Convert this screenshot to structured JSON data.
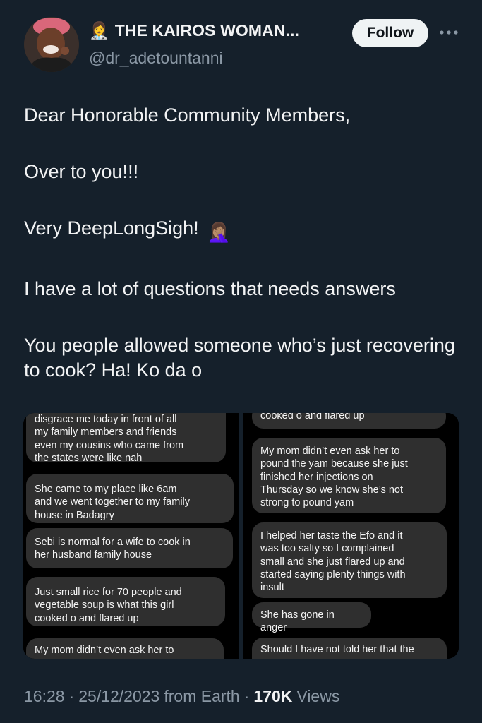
{
  "author": {
    "display_name": "THE KAIROS WOMAN...",
    "badge_emoji": "👩‍⚕️",
    "handle": "@dr_adetountanni",
    "avatar_icon": "avatar-photo"
  },
  "actions": {
    "follow_label": "Follow",
    "more_icon": "more-icon"
  },
  "tweet": {
    "paragraphs": [
      "Dear Honorable Community Members,",
      "Over to you!!!",
      "Very DeepLongSigh!",
      "I have a lot of questions that needs answers",
      "You people allowed someone who’s just recovering to cook? Ha! Ko da o"
    ],
    "facepalm_emoji": "🤦🏽‍♀️"
  },
  "media": {
    "left_messages": [
      "disgrace me today in front of all\nmy family members and friends\neven my cousins who came from\nthe states were like nah",
      "She came to my place like 6am\nand we went together to my family\nhouse in Badagry",
      "Sebi is normal for a wife to cook in\nher husband family house",
      "Just small rice for 70 people and\nvegetable soup is what this girl\ncooked o and flared up",
      "My mom didn’t even ask her to"
    ],
    "right_messages": [
      "cooked o and flared up",
      "My mom didn’t even ask her to\npound the yam because she just\nfinished her injections on\nThursday so we know she’s not\nstrong to pound yam",
      "I helped her taste the Efo and it\nwas too salty so I complained\nsmall and she just flared up and\nstarted saying plenty things with\ninsult",
      "She has gone in anger",
      "Should I have not told her that the"
    ]
  },
  "footer": {
    "time": "16:28",
    "separator": "·",
    "date": "25/12/2023",
    "source": "from Earth",
    "views_count": "170K",
    "views_label": "Views"
  },
  "colors": {
    "background": "#15202b",
    "text": "#e7e9ea",
    "muted": "#8b98a5",
    "bubble": "#2f2f2f"
  }
}
